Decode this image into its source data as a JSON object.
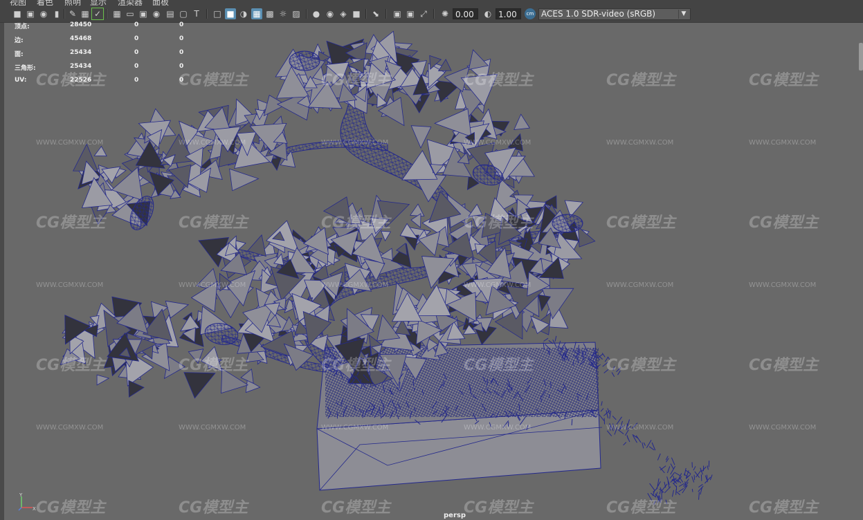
{
  "menubar": {
    "items": [
      "视图",
      "着色",
      "照明",
      "显示",
      "渲染器",
      "面板"
    ]
  },
  "toolbar": {
    "field1": "0.00",
    "field2": "1.00",
    "color_management": "ACES 1.0 SDR-video (sRGB)"
  },
  "hud": {
    "rows": [
      {
        "label": "顶点:",
        "a": "28450",
        "b": "0",
        "c": "0"
      },
      {
        "label": "边:",
        "a": "45468",
        "b": "0",
        "c": "0"
      },
      {
        "label": "面:",
        "a": "25434",
        "b": "0",
        "c": "0"
      },
      {
        "label": "三角形:",
        "a": "25434",
        "b": "0",
        "c": "0"
      },
      {
        "label": "UV:",
        "a": "22526",
        "b": "0",
        "c": "0"
      }
    ]
  },
  "viewport": {
    "camera_label": "persp",
    "axis_y": "Y",
    "axis_x": "X"
  },
  "watermark": {
    "logo_text": "CG模型主",
    "url": "WWW.CGMXW.COM"
  },
  "colors": {
    "wireframe": "#232a8a",
    "face": "#8a8a92",
    "background": "#686868",
    "toolbar_active": "#5a8fb2"
  }
}
